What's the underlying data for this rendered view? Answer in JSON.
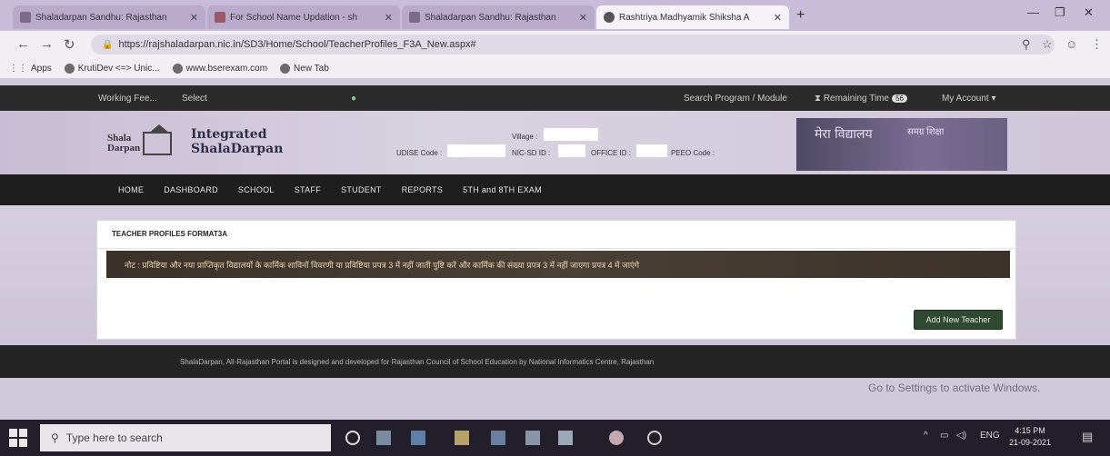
{
  "browser": {
    "tabs": [
      {
        "label": "Shaladarpan Sandhu: Rajasthan",
        "active": false
      },
      {
        "label": "For School Name Updation - sh",
        "active": false
      },
      {
        "label": "Shaladarpan Sandhu: Rajasthan",
        "active": false
      },
      {
        "label": "Rashtriya Madhyamik Shiksha A",
        "active": true
      }
    ],
    "url": "https://rajshaladarpan.nic.in/SD3/Home/School/TeacherProfiles_F3A_New.aspx#",
    "bookmarks": [
      "Apps",
      "KrutiDev <=> Unic...",
      "www.bserexam.com",
      "New Tab"
    ]
  },
  "site": {
    "topbar": {
      "left1": "Working Fee...",
      "left2": "Select",
      "search": "Search Program / Module",
      "remaining": "Remaining Time",
      "remaining_badge": "56",
      "account": "My Account ▾"
    },
    "logo": {
      "line1": "Shala",
      "line2": "Darpan"
    },
    "title_line1": "Integrated",
    "title_line2": "ShalaDarpan",
    "fields": {
      "village": "Village :",
      "udise": "UDISE Code :",
      "nic_sd_id": "NIC-SD ID :",
      "office_id": "OFFICE ID :",
      "peeo": "PEEO Code :"
    },
    "emblem": {
      "left": "मेरा विद्यालय",
      "right": "समग्र शिक्षा"
    },
    "nav": [
      "HOME",
      "DASHBOARD",
      "SCHOOL",
      "STAFF",
      "STUDENT",
      "REPORTS",
      "5TH and 8TH EXAM"
    ],
    "panel_title": "TEACHER PROFILES FORMAT3A",
    "notice": "नोट : प्रविष्टिया और नया प्राप्तिकृत विद्यालयों के कार्मिक शाविनों विवरणी या प्रविष्टिया प्रपत्र 3 में नहीं जाती पुष्टि करें और कार्मिक की संख्या प्रपत्र 3 में नहीं जाएगा प्रपत्र 4 में जाएंगे",
    "add_button": "Add New Teacher",
    "footer": "ShalaDarpan, All-Rajasthan Portal is designed and developed for Rajasthan Council of School Education by National Informatics Centre, Rajasthan"
  },
  "os": {
    "activate": "Go to Settings to activate Windows.",
    "search_placeholder": "Type here to search",
    "lang": "ENG",
    "time": "4:15 PM",
    "date": "21-09-2021"
  }
}
